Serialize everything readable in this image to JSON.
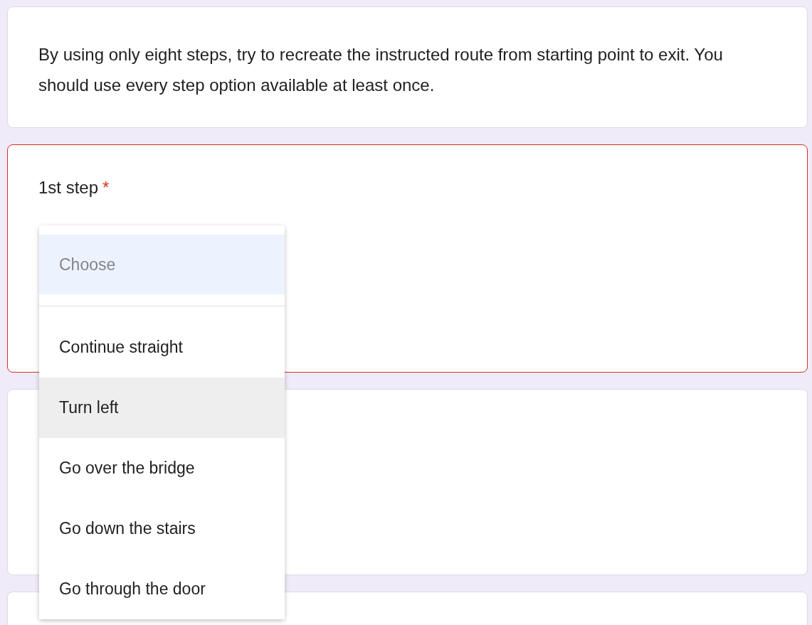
{
  "description": "By using only eight steps, try to recreate the instructed route from starting point to exit. You should use every step option available at least once.",
  "question": {
    "title": "1st step",
    "required": true,
    "required_mark": "*",
    "error": true
  },
  "dropdown": {
    "placeholder": {
      "label": "Choose",
      "selected": true
    },
    "options": [
      {
        "label": "Continue straight",
        "selected": false,
        "highlighted": false
      },
      {
        "label": "Turn left",
        "selected": false,
        "highlighted": true
      },
      {
        "label": "Go over the bridge",
        "selected": false,
        "highlighted": false
      },
      {
        "label": "Go down the stairs",
        "selected": false,
        "highlighted": false
      },
      {
        "label": "Go through the door",
        "selected": false,
        "highlighted": false
      }
    ]
  }
}
